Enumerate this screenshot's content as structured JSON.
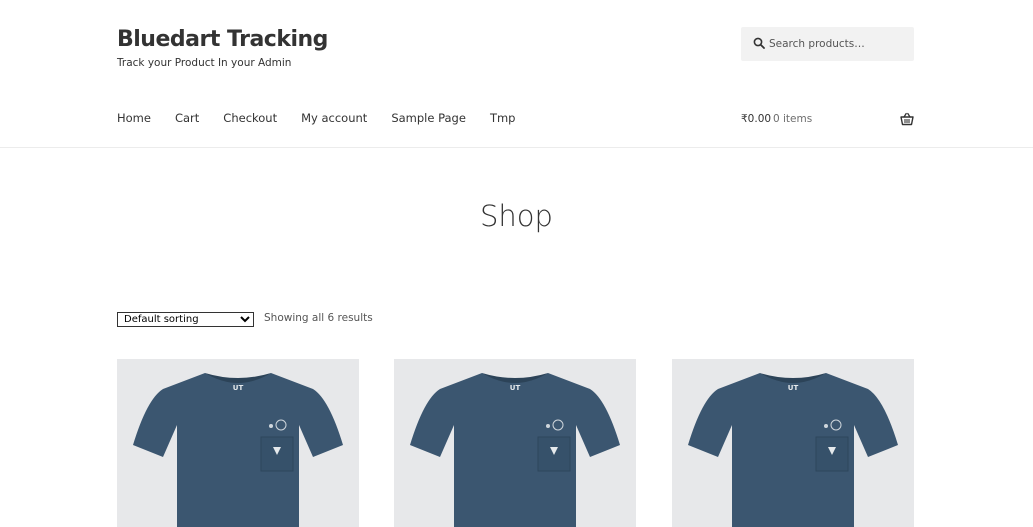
{
  "site": {
    "title": "Bluedart Tracking",
    "tagline": "Track your Product In your Admin"
  },
  "search": {
    "placeholder": "Search products…",
    "icon": "search-icon"
  },
  "nav": {
    "items": [
      "Home",
      "Cart",
      "Checkout",
      "My account",
      "Sample Page",
      "Tmp"
    ]
  },
  "cart": {
    "amount": "₹0.00",
    "count": "0 items",
    "icon": "basket-icon"
  },
  "page": {
    "title": "Shop"
  },
  "shop": {
    "sort_selected": "Default sorting",
    "result_count": "Showing all 6 results",
    "product_image_label": "UT"
  },
  "colors": {
    "text": "#333333",
    "muted": "#6d6d6d",
    "search_bg": "#f2f2f2",
    "shirt": "#3b5670"
  }
}
